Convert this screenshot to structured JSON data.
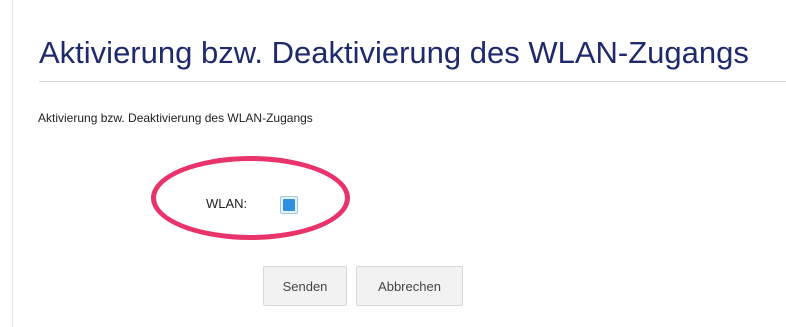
{
  "page": {
    "title": "Aktivierung bzw. Deaktivierung des WLAN-Zugangs",
    "description": "Aktivierung bzw. Deaktivierung des WLAN-Zugangs"
  },
  "form": {
    "wlan_label": "WLAN:",
    "wlan_checked": true
  },
  "buttons": {
    "send_label": "Senden",
    "cancel_label": "Abbrechen"
  },
  "colors": {
    "title": "#1e2a6b",
    "highlight": "#e8336b",
    "checkbox_accent": "#2f8fe0"
  },
  "icons": {
    "wlan_checkbox": "checkbox-checked-icon"
  }
}
